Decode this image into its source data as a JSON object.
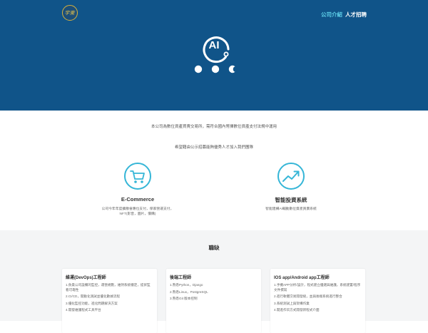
{
  "header": {
    "logo_text": "宇東",
    "nav": [
      {
        "label": "公司介紹"
      },
      {
        "label": "人才招聘"
      }
    ]
  },
  "hero": {
    "ai_badge_text": "AI"
  },
  "intro": {
    "line1": "本公司為數位資產買賣交易所，需符合國內幣擇數位資產支付法規中運用",
    "line2": "希望藉由公示招募能夠優秀人才加入我們團隊"
  },
  "features": [
    {
      "icon": "shopping-cart-icon",
      "title": "E-Commerce",
      "desc": [
        "公司今年年度擴散會應位支付，保家營運支付，",
        "NFT(影音，圖片，價購)"
      ]
    },
    {
      "icon": "trend-chart-icon",
      "title": "智能投資系統",
      "desc": [
        "智能建構AI輔動數位資產買賣系統"
      ]
    }
  ],
  "jobs": {
    "heading": "職缺",
    "cards": [
      {
        "title": "維運(DevOps)工程師",
        "items": [
          "1.負責公司設備的監控，運營規劃，維持系統穩定，提昇監看可靠性",
          "2.CI/CD，開動化測試並優化數據流程",
          "3.優化監控功能，進化問題解決方案",
          "4.開發維護程式工具平台"
        ]
      },
      {
        "title": "後端工程師",
        "items": [
          "1.熟悉Python，Django",
          "2.熟悉Linux，PostgreSQL",
          "3.熟悉Git 版本控制"
        ]
      },
      {
        "title": "IOS app/Android app工程師",
        "items": [
          "1.手機APP分析/設計，程式建立優選與維護，系統建置/程序文件撰寫",
          "2.進行軟體交易開發統，並與後端系統進行整合",
          "3.系統測試上與架構作業",
          "4.開進作伝方式開發新程式介面"
        ]
      }
    ]
  },
  "colors": {
    "hero_bg": "#105489",
    "nav_active": "#5fd1ea",
    "icon_accent": "#36b6d7",
    "jobs_bg": "#f4f5f6"
  }
}
